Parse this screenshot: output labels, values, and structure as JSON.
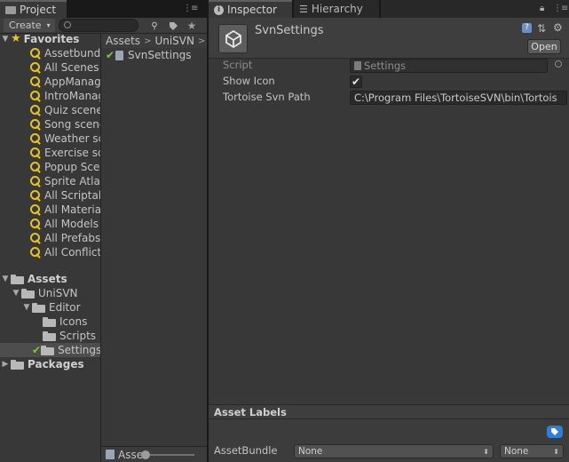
{
  "project": {
    "tab_label": "Project",
    "create_label": "Create",
    "favorites_label": "Favorites",
    "favorites": [
      "Assetbundl",
      "All Scenes",
      "AppManage",
      "IntroManag",
      "Quiz scene",
      "Song scene",
      "Weather sc",
      "Exercise sc",
      "Popup Scer",
      "Sprite Atlas",
      "All Scriptab",
      "All Material",
      "All Models",
      "All Prefabs",
      "All Conflicte"
    ],
    "assets_label": "Assets",
    "unisvn_label": "UniSVN",
    "editor_label": "Editor",
    "icons_label": "Icons",
    "scripts_label": "Scripts",
    "settings_label": "Settings",
    "packages_label": "Packages",
    "breadcrumb": [
      "Assets",
      "UniSVN"
    ],
    "file_name": "SvnSettings",
    "footer_label": "Asse"
  },
  "inspector": {
    "tab_label": "Inspector",
    "hierarchy_tab_label": "Hierarchy",
    "object_name": "SvnSettings",
    "open_label": "Open",
    "script_label": "Script",
    "script_value": "Settings",
    "show_icon_label": "Show Icon",
    "show_icon_checked": true,
    "svn_path_label": "Tortoise Svn Path",
    "svn_path_value": "C:\\Program Files\\TortoiseSVN\\bin\\Tortois",
    "asset_labels_title": "Asset Labels",
    "assetbundle_label": "AssetBundle",
    "bundle_value": "None",
    "variant_value": "None"
  },
  "colors": {
    "favorite_star": "#f2c41a",
    "svn_check": "#7ec640",
    "tag_blue": "#2f7fd6"
  }
}
